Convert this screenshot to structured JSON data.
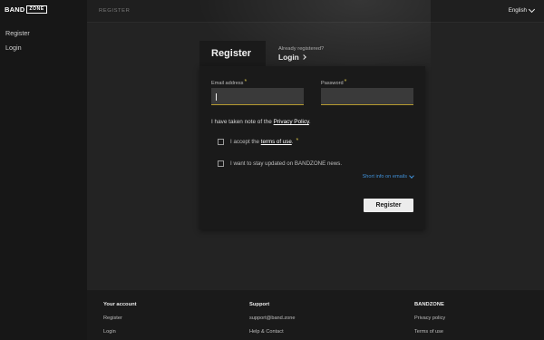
{
  "brand": {
    "band": "BAND",
    "zone": "ZONE"
  },
  "sidebar": {
    "items": [
      {
        "label": "Register"
      },
      {
        "label": "Login"
      }
    ]
  },
  "topbar": {
    "breadcrumb": "REGISTER",
    "language": "English"
  },
  "tabs": {
    "register": "Register",
    "already_registered": "Already registered?",
    "login": "Login"
  },
  "form": {
    "email_label": "Email address",
    "password_label": "Password",
    "required_mark": "*",
    "email_value": "",
    "password_value": "",
    "privacy_prefix": "I have taken note of the ",
    "privacy_link": "Privacy Policy",
    "privacy_suffix": ".",
    "terms_prefix": "I accept the ",
    "terms_link": "terms of use",
    "terms_suffix": ".",
    "newsletter": "I want to stay updated on BANDZONE news.",
    "short_info": "Short info on emails",
    "submit": "Register"
  },
  "footer": {
    "columns": [
      {
        "title": "Your account",
        "links": [
          "Register",
          "Login"
        ]
      },
      {
        "title": "Support",
        "links": [
          "support@band.zone",
          "Help & Contact"
        ]
      },
      {
        "title": "BANDZONE",
        "links": [
          "Privacy policy",
          "Terms of use"
        ]
      }
    ]
  },
  "colors": {
    "accent": "#d9c34a",
    "link": "#3f8fd6",
    "background": "#232323"
  }
}
